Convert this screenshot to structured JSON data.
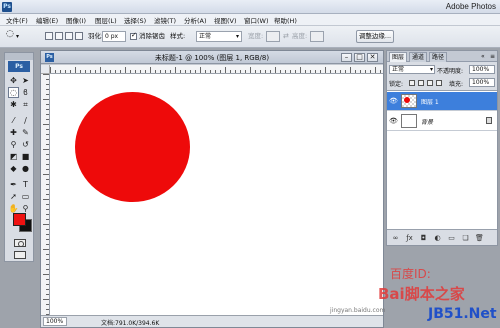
{
  "app": {
    "title": "Adobe Photos",
    "logo": "Ps"
  },
  "menu": [
    "文件(F)",
    "编辑(E)",
    "图像(I)",
    "图层(L)",
    "选择(S)",
    "滤镜(T)",
    "分析(A)",
    "视图(V)",
    "窗口(W)",
    "帮助(H)"
  ],
  "options_bar": {
    "feather_label": "羽化:",
    "feather_value": "0 px",
    "antialias_label": "消除锯齿",
    "style_label": "样式:",
    "style_value": "正常",
    "width_label": "宽度:",
    "height_label": "高度:",
    "refine_edge_button": "调整边缘..."
  },
  "tools": {
    "badge": "Ps",
    "items": [
      "move-tool",
      "marquee-tool",
      "lasso-tool",
      "magic-wand-tool",
      "crop-tool",
      "slice-tool",
      "healing-brush-tool",
      "brush-tool",
      "clone-stamp-tool",
      "history-brush-tool",
      "eraser-tool",
      "gradient-tool",
      "blur-tool",
      "dodge-tool",
      "pen-tool",
      "type-tool",
      "path-selection-tool",
      "shape-tool",
      "notes-tool",
      "eyedropper-tool",
      "hand-tool",
      "zoom-tool"
    ],
    "foreground_color": "#ee1111",
    "background_color": "#111111"
  },
  "document": {
    "title": "未标题-1 @ 100% (图层 1, RGB/8)",
    "zoom": "100%",
    "doc_info": "文档:791.0K/394.6K",
    "shape_color": "#ee0a0a"
  },
  "layers_panel": {
    "tabs": [
      "图层",
      "通道",
      "路径"
    ],
    "blend_mode": "正常",
    "opacity_label": "不透明度:",
    "opacity_value": "100%",
    "lock_label": "锁定:",
    "fill_label": "填充:",
    "fill_value": "100%",
    "layers": [
      {
        "name": "图层 1",
        "selected": true,
        "visible": true
      },
      {
        "name": "背景",
        "selected": false,
        "visible": true,
        "locked": true
      }
    ]
  },
  "watermark": {
    "baidu_label": "百度ID:",
    "site_text": "Bai脚本之家",
    "url": "jingyan.baidu.com",
    "domain": "JB51.Net"
  }
}
